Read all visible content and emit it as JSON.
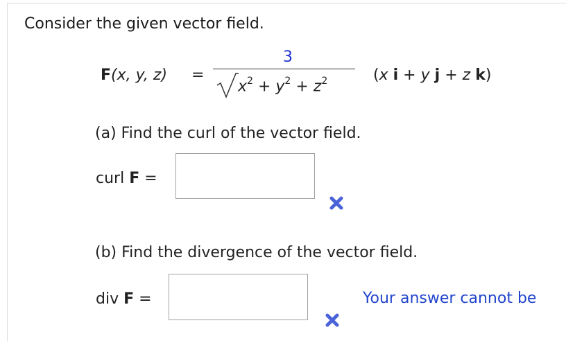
{
  "intro": "Consider the given vector field.",
  "formula": {
    "F": "F",
    "args": "(x, y, z)",
    "equals": "=",
    "numerator": "3",
    "denominator": {
      "x": "x",
      "y": "y",
      "z": "z",
      "exp": "2",
      "plus": "+"
    },
    "vector": {
      "open": "(",
      "x": "x",
      "i": "i",
      "y": "y",
      "j": "j",
      "z": "z",
      "k": "k",
      "plus": "+",
      "close": ")"
    }
  },
  "part_a": {
    "prompt": "(a) Find the curl of the vector field.",
    "label_prefix": "curl",
    "label_bold": "F",
    "label_suffix": "=",
    "answer_value": "",
    "status_icon": "incorrect-x-icon"
  },
  "part_b": {
    "prompt": "(b) Find the divergence of the vector field.",
    "label_prefix": "div",
    "label_bold": "F",
    "label_suffix": "=",
    "answer_value": "",
    "status_icon": "incorrect-x-icon",
    "feedback": "Your answer cannot be"
  },
  "colors": {
    "accent_blue": "#2233cc",
    "incorrect_mark": "#4a63d8",
    "feedback_text": "#2245cc"
  }
}
